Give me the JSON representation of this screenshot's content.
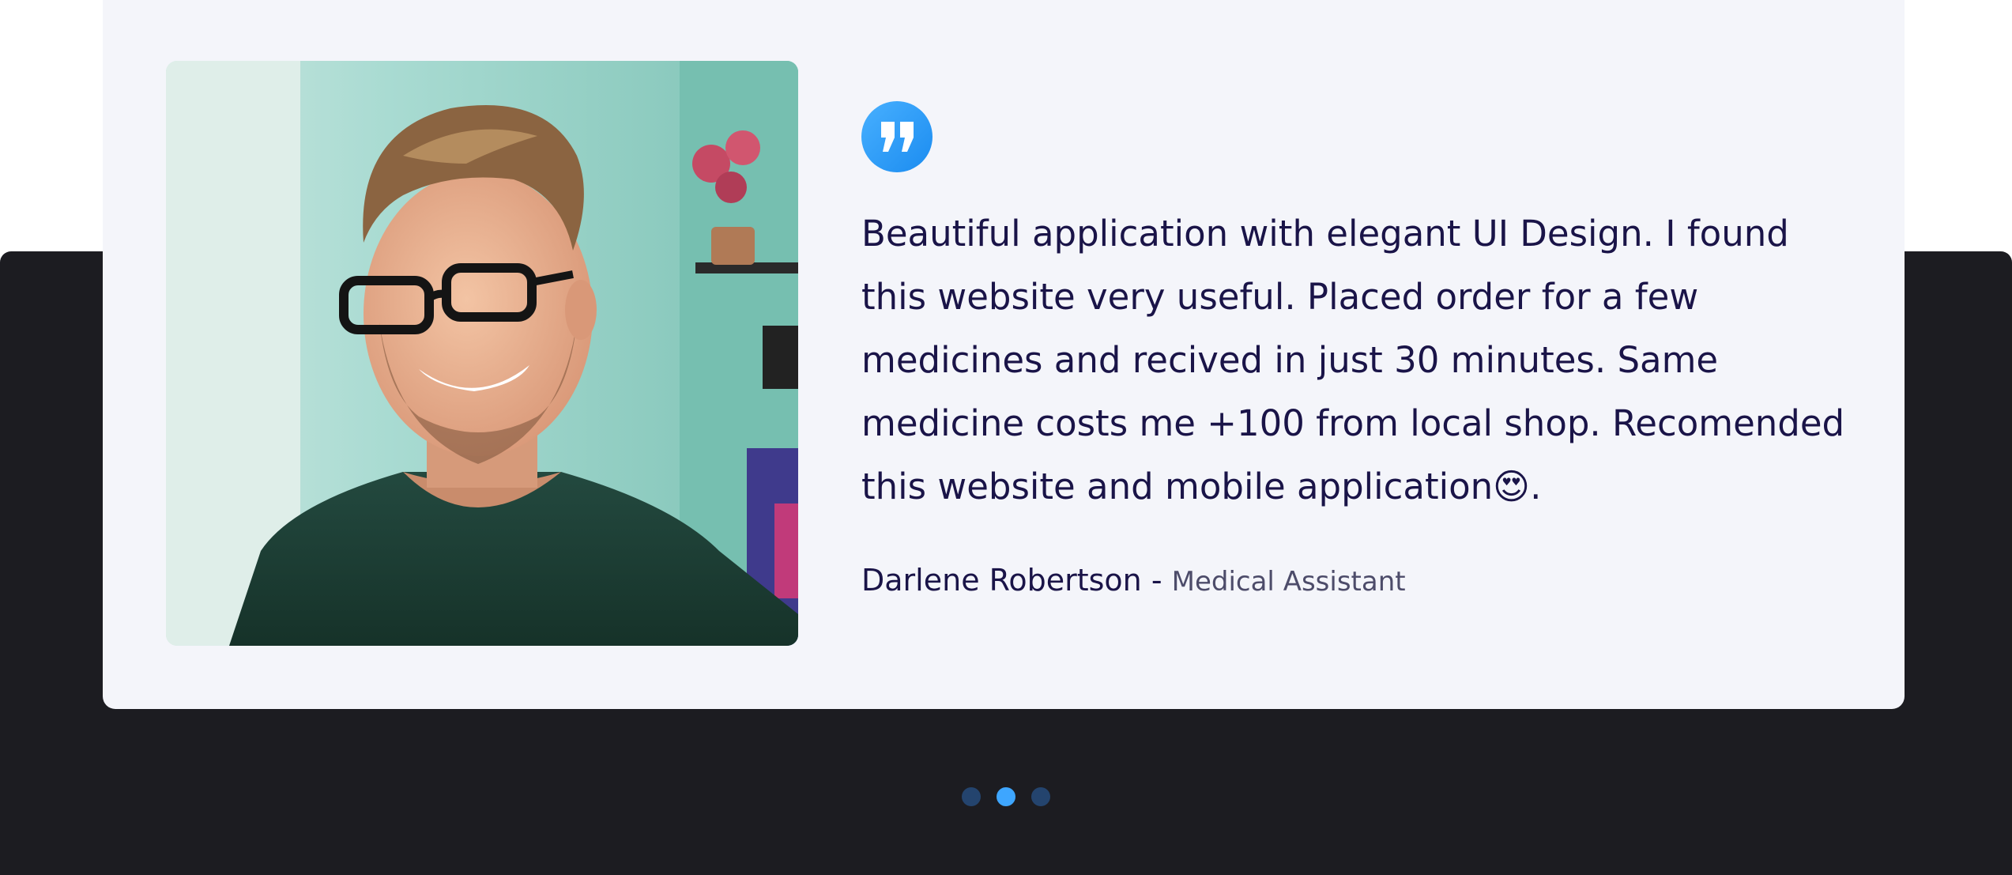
{
  "testimonial": {
    "quote_icon": "quote-icon",
    "text": "Beautiful application with elegant UI Design. I found\nthis website very useful. Placed order for a few\nmedicines and recived in just 30 minutes. Same\nmedicine costs me +100 from local shop. Recomended\nthis website and mobile application😍.",
    "author_name": "Darlene Robertson",
    "author_separator": " - ",
    "author_role": "Medical Assistant",
    "photo_icon": "person-photo"
  },
  "carousel": {
    "slide_count": 3,
    "active_slide": 2
  },
  "colors": {
    "accent": "#3ea6ff",
    "dark_background": "#1c1c21",
    "card_background": "#f4f5fa",
    "text_primary": "#1a1448"
  }
}
